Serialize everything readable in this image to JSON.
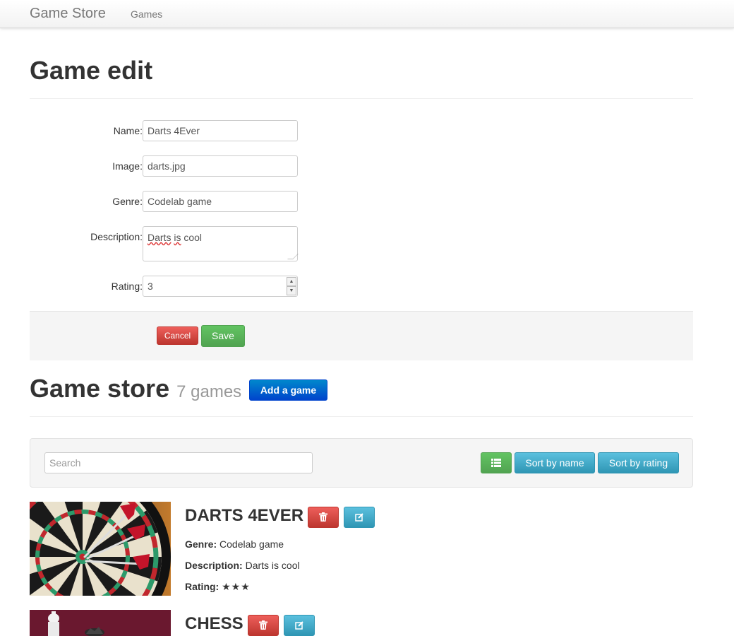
{
  "navbar": {
    "brand": "Game Store",
    "link_games": "Games"
  },
  "edit": {
    "title": "Game edit",
    "fields": {
      "name": {
        "label": "Name:",
        "value": "Darts 4Ever"
      },
      "image": {
        "label": "Image:",
        "value": "darts.jpg"
      },
      "genre": {
        "label": "Genre:",
        "value": "Codelab game"
      },
      "description": {
        "label": "Description:",
        "value_word1": "Darts",
        "value_word2": "is",
        "value_rest": "cool"
      },
      "rating": {
        "label": "Rating:",
        "value": "3"
      }
    },
    "cancel_label": "Cancel",
    "save_label": "Save"
  },
  "store": {
    "title": "Game store",
    "count_text": "7 games",
    "add_label": "Add a game",
    "search_placeholder": "Search",
    "sort_by_name": "Sort by name",
    "sort_by_rating": "Sort by rating",
    "icons": {
      "list": "list-icon",
      "trash": "trash-icon",
      "edit": "edit-icon",
      "star": "star-icon"
    },
    "genre_label": "Genre:",
    "description_label": "Description:",
    "rating_label": "Rating:",
    "games": [
      {
        "title": "DARTS 4EVER",
        "genre": "Codelab game",
        "description": "Darts is cool",
        "rating_stars": "★★★",
        "rating": 3
      },
      {
        "title": "CHESS"
      }
    ]
  },
  "colors": {
    "danger": "#d9534f",
    "success": "#5cb85c",
    "primary": "#0055cc",
    "info": "#49afcd"
  }
}
